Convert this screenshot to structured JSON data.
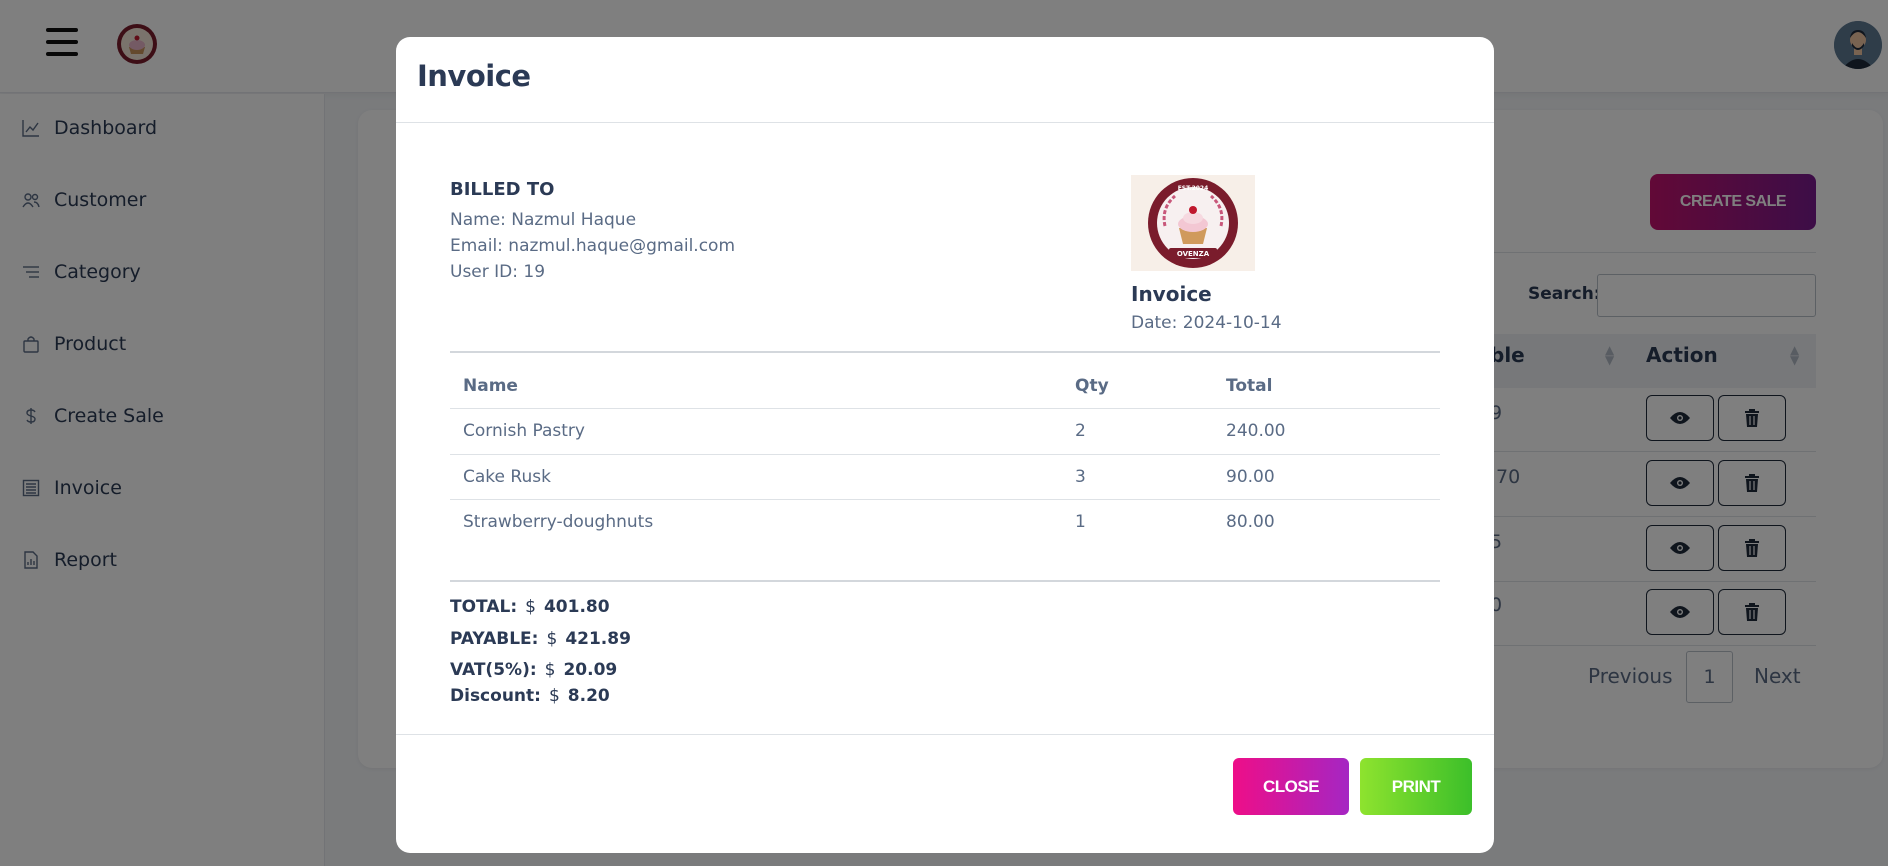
{
  "sidebar": {
    "items": [
      {
        "label": "Dashboard",
        "icon": "chart-line-icon"
      },
      {
        "label": "Customer",
        "icon": "users-icon"
      },
      {
        "label": "Category",
        "icon": "list-icon"
      },
      {
        "label": "Product",
        "icon": "bag-icon"
      },
      {
        "label": "Create Sale",
        "icon": "dollar-icon"
      },
      {
        "label": "Invoice",
        "icon": "invoice-icon"
      },
      {
        "label": "Report",
        "icon": "report-icon"
      }
    ]
  },
  "background": {
    "create_sale_label": "CREATE SALE",
    "search_label": "Search:",
    "columns": [
      "ble",
      "Action"
    ],
    "row_values": [
      "9",
      ".70",
      "5",
      "0"
    ],
    "pagination": {
      "previous": "Previous",
      "page": "1",
      "next": "Next"
    }
  },
  "modal": {
    "title": "Invoice",
    "billed_to": {
      "heading": "BILLED TO",
      "name": "Name: Nazmul Haque",
      "email": "Email: nazmul.haque@gmail.com",
      "user_id": "User ID: 19"
    },
    "logo_text": {
      "top": "EST.2024",
      "bottom": "OVENZA"
    },
    "invoice_heading": "Invoice",
    "date": "Date: 2024-10-14",
    "table": {
      "headers": [
        "Name",
        "Qty",
        "Total"
      ],
      "rows": [
        {
          "name": "Cornish Pastry",
          "qty": "2",
          "total": "240.00"
        },
        {
          "name": "Cake Rusk",
          "qty": "3",
          "total": "90.00"
        },
        {
          "name": "Strawberry-doughnuts",
          "qty": "1",
          "total": "80.00"
        }
      ]
    },
    "summary": [
      {
        "label": "TOTAL:",
        "currency": "$",
        "value": "401.80"
      },
      {
        "label": "PAYABLE:",
        "currency": "$",
        "value": "421.89"
      },
      {
        "label": "VAT(5%):",
        "currency": "$",
        "value": "20.09"
      },
      {
        "label": "Discount:",
        "currency": "$",
        "value": "8.20"
      }
    ],
    "buttons": {
      "close": "CLOSE",
      "print": "PRINT"
    }
  },
  "colors": {
    "brand_gradient_start": "#ee0e88",
    "brand_gradient_end": "#a526c3",
    "print_gradient_start": "#8ee32e",
    "print_gradient_end": "#3cbf2a",
    "text_primary": "#2b3a55",
    "text_secondary": "#5a6b85"
  }
}
